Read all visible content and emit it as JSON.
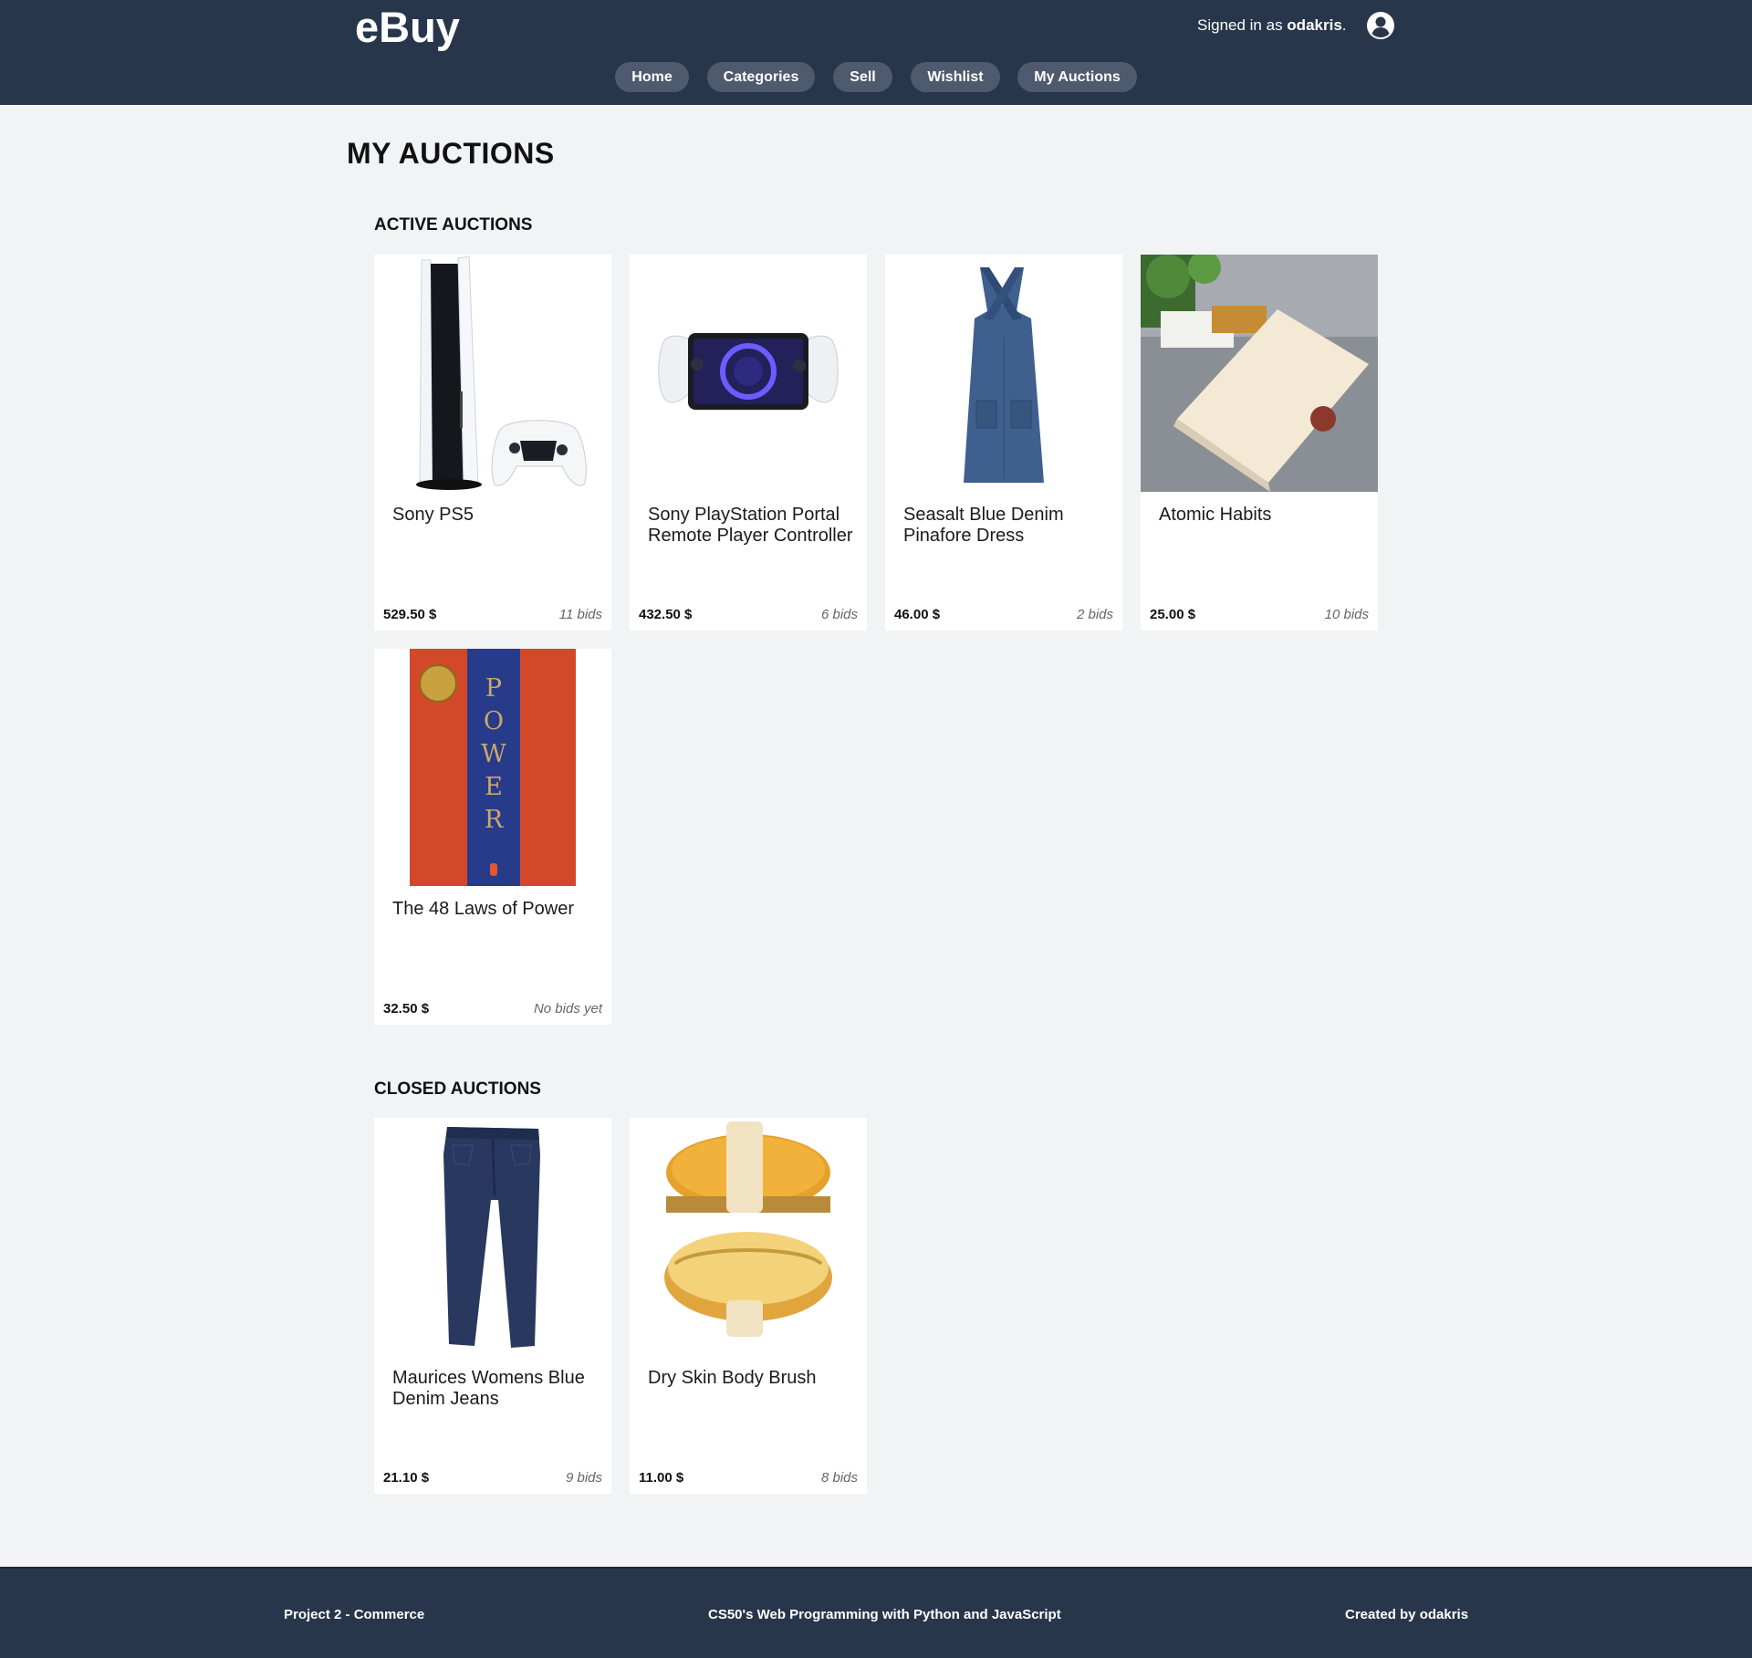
{
  "header": {
    "logo": "eBuy",
    "signed_in_prefix": "Signed in as ",
    "username": "odakris",
    "signed_in_suffix": ".",
    "nav": [
      {
        "label": "Home"
      },
      {
        "label": "Categories"
      },
      {
        "label": "Sell"
      },
      {
        "label": "Wishlist"
      },
      {
        "label": "My Auctions"
      }
    ]
  },
  "page": {
    "title": "MY AUCTIONS"
  },
  "active": {
    "title": "ACTIVE AUCTIONS",
    "items": [
      {
        "title": "Sony PS5",
        "price": "529.50 $",
        "bids": "11 bids",
        "image": "ps5-console-image"
      },
      {
        "title": "Sony PlayStation Portal Remote Player Controller",
        "price": "432.50 $",
        "bids": "6 bids",
        "image": "playstation-portal-image"
      },
      {
        "title": "Seasalt Blue Denim Pinafore Dress",
        "price": "46.00 $",
        "bids": "2 bids",
        "image": "denim-dress-image"
      },
      {
        "title": "Atomic Habits",
        "price": "25.00 $",
        "bids": "10 bids",
        "image": "atomic-habits-book-image"
      },
      {
        "title": "The 48 Laws of Power",
        "price": "32.50 $",
        "bids": "No bids yet",
        "image": "48-laws-book-image"
      }
    ]
  },
  "closed": {
    "title": "CLOSED AUCTIONS",
    "items": [
      {
        "title": "Maurices Womens Blue Denim Jeans",
        "price": "21.10 $",
        "bids": "9 bids",
        "image": "denim-jeans-image"
      },
      {
        "title": "Dry Skin Body Brush",
        "price": "11.00 $",
        "bids": "8 bids",
        "image": "body-brush-image"
      }
    ]
  },
  "book_cover": {
    "power_letters": [
      "P",
      "O",
      "W",
      "E",
      "R"
    ]
  },
  "footer": {
    "left": "Project 2 - Commerce",
    "center": "CS50's Web Programming with Python and JavaScript",
    "right": "Created by odakris"
  },
  "colors": {
    "header_bg": "#27364a",
    "nav_pill": "#4e5a6d",
    "page_bg": "#f2f3f5",
    "card_bg": "#ffffff"
  }
}
